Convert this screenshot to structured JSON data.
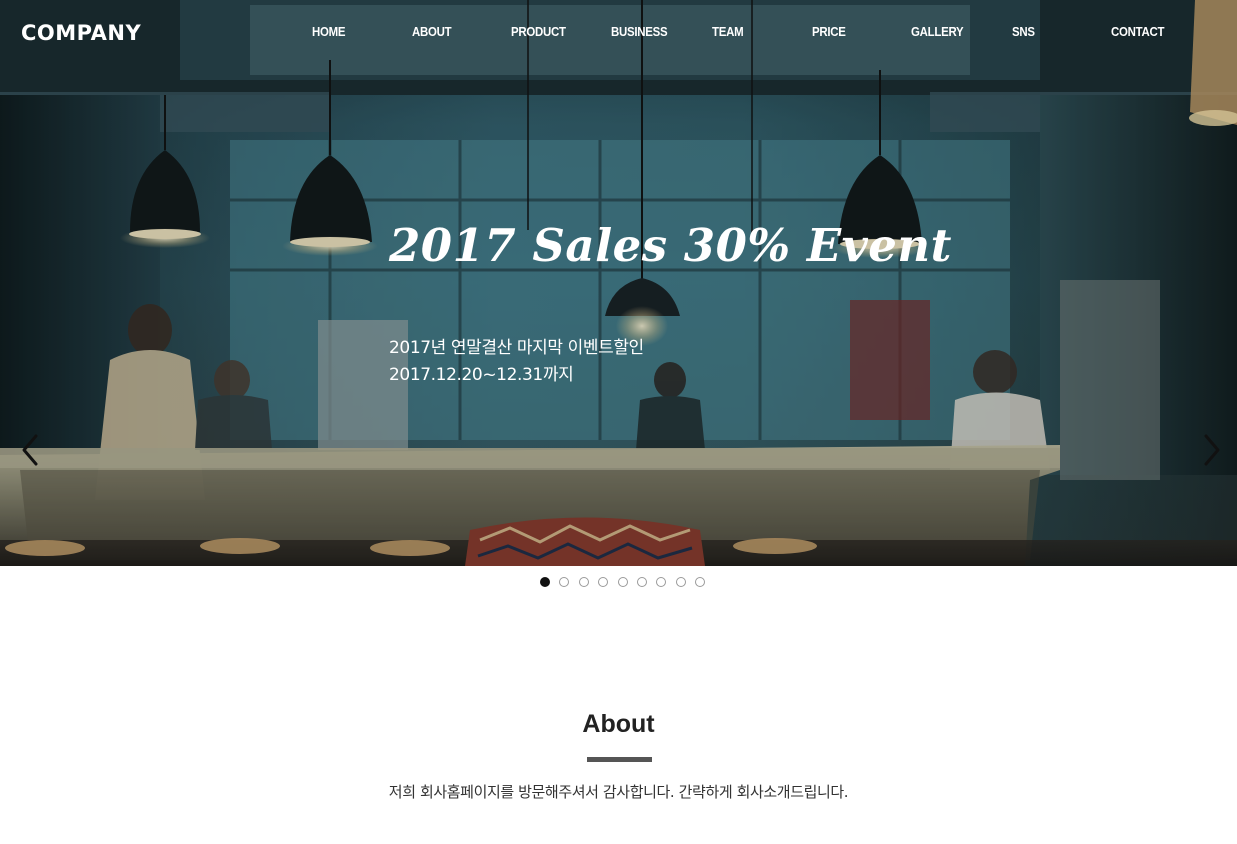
{
  "header": {
    "logo": "COMPANY",
    "nav": [
      "HOME",
      "ABOUT",
      "PRODUCT",
      "BUSINESS",
      "TEAM",
      "PRICE",
      "GALLERY",
      "SNS",
      "CONTACT"
    ]
  },
  "hero": {
    "title": "2017 Sales 30% Event",
    "subtitle_line1": "2017년 연말결산 마지막 이벤트할인",
    "subtitle_line2": "2017.12.20~12.31까지",
    "prev_icon": "chevron-left-icon",
    "next_icon": "chevron-right-icon",
    "background": "blurred cafe kitchen interior with pendant lamps"
  },
  "slider": {
    "total_slides": 9,
    "active_index": 0
  },
  "about": {
    "title": "About",
    "description": "저희 회사홈페이지를 방문해주셔서 감사합니다. 간략하게 회사소개드립니다."
  },
  "colors": {
    "hero_tint": "#3d7282",
    "text_light": "#ffffff",
    "about_bar": "#555555",
    "dot_active": "#111111",
    "dot_border": "#9a9a9a"
  }
}
